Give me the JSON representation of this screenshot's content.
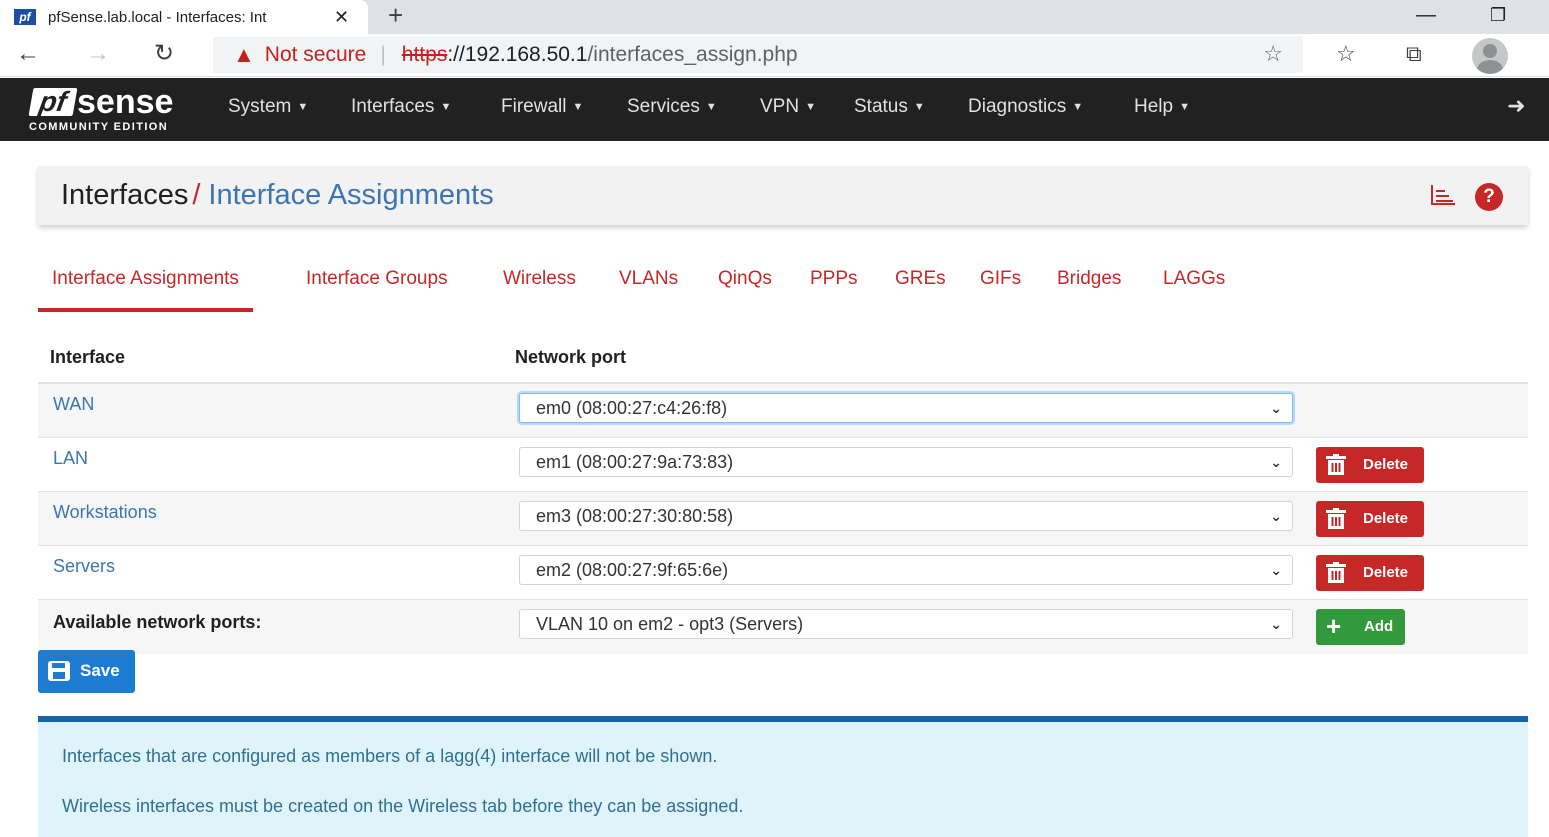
{
  "browser": {
    "tab_title": "pfSense.lab.local - Interfaces: Int",
    "favicon_text": "pf",
    "not_secure_label": "Not secure",
    "url_scheme": "https",
    "url_host": "://192.168.50.1",
    "url_path": "/interfaces_assign.php"
  },
  "brand": {
    "logo_pf": "pf",
    "logo_sense": "sense",
    "logo_edition": "COMMUNITY EDITION"
  },
  "menu": [
    {
      "label": "System"
    },
    {
      "label": "Interfaces"
    },
    {
      "label": "Firewall"
    },
    {
      "label": "Services"
    },
    {
      "label": "VPN"
    },
    {
      "label": "Status"
    },
    {
      "label": "Diagnostics"
    },
    {
      "label": "Help"
    }
  ],
  "breadcrumb": {
    "parent": "Interfaces",
    "separator": "/",
    "current": "Interface Assignments"
  },
  "tabs": [
    {
      "label": "Interface Assignments",
      "active": true
    },
    {
      "label": "Interface Groups"
    },
    {
      "label": "Wireless"
    },
    {
      "label": "VLANs"
    },
    {
      "label": "QinQs"
    },
    {
      "label": "PPPs"
    },
    {
      "label": "GREs"
    },
    {
      "label": "GIFs"
    },
    {
      "label": "Bridges"
    },
    {
      "label": "LAGGs"
    }
  ],
  "table": {
    "col_interface": "Interface",
    "col_port": "Network port",
    "rows": [
      {
        "interface": "WAN",
        "port": "em0 (08:00:27:c4:26:f8)"
      },
      {
        "interface": "LAN",
        "port": "em1 (08:00:27:9a:73:83)",
        "action": "Delete"
      },
      {
        "interface": "Workstations",
        "port": "em3 (08:00:27:30:80:58)",
        "action": "Delete"
      },
      {
        "interface": "Servers",
        "port": "em2 (08:00:27:9f:65:6e)",
        "action": "Delete"
      }
    ],
    "available_label": "Available network ports:",
    "available_value": "VLAN 10 on em2 - opt3 (Servers)",
    "add_label": "Add"
  },
  "save_label": "Save",
  "info": [
    "Interfaces that are configured as members of a lagg(4) interface will not be shown.",
    "Wireless interfaces must be created on the Wireless tab before they can be assigned."
  ],
  "colors": {
    "accent_red": "#c62828",
    "link_blue": "#3b76b2",
    "save_blue": "#1e7bd2",
    "add_green": "#33993d",
    "navbar": "#212121"
  }
}
